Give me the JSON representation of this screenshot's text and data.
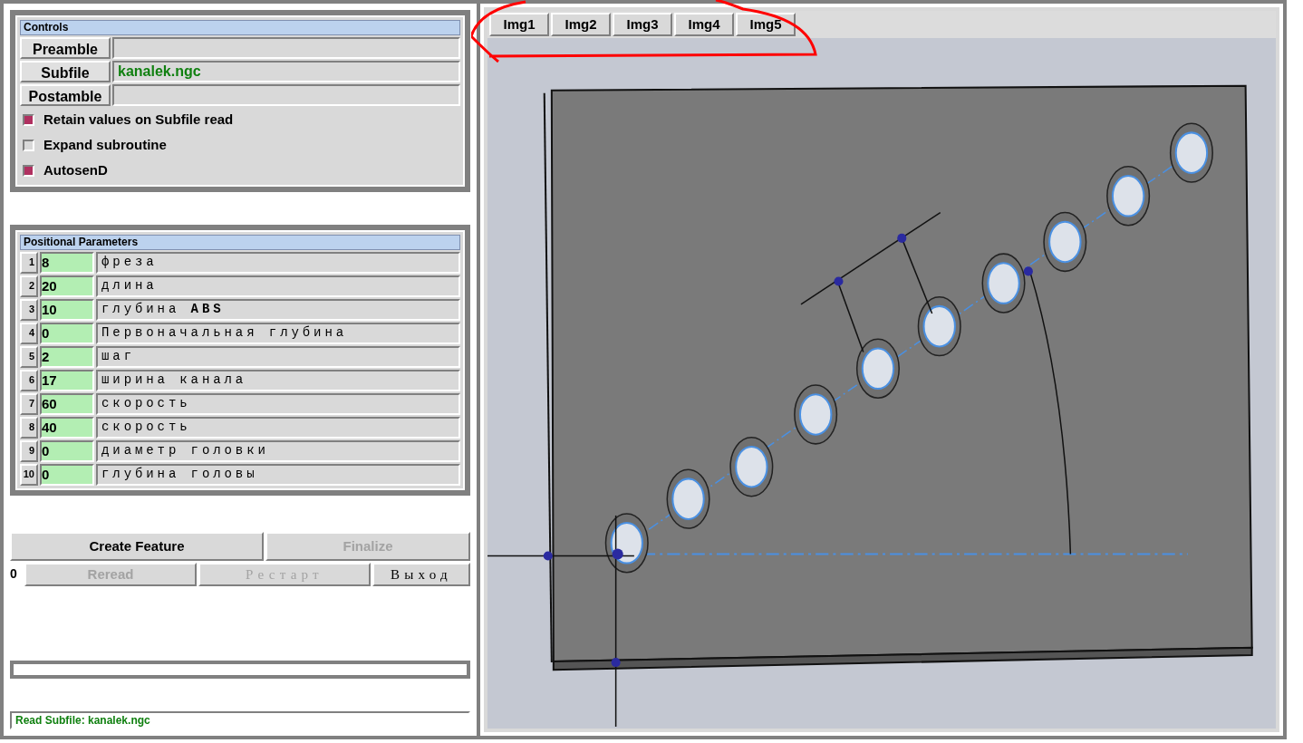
{
  "controls": {
    "title": "Controls",
    "file_rows": [
      {
        "button": "Preamble"
      },
      {
        "button": "Subfile",
        "value": "kanalek.ngc"
      },
      {
        "button": "Postamble"
      }
    ],
    "checkboxes": [
      {
        "label": "Retain values on Subfile read",
        "checked": true
      },
      {
        "label": "Expand subroutine",
        "checked": false
      },
      {
        "label": "AutosenD",
        "checked": true
      }
    ]
  },
  "positional_parameters": {
    "title": "Positional Parameters",
    "rows": [
      {
        "index": "1",
        "value": "8",
        "label": "фреза"
      },
      {
        "index": "2",
        "value": "20",
        "label": "длина"
      },
      {
        "index": "3",
        "value": "10",
        "label": "глубина **ABS**"
      },
      {
        "index": "4",
        "value": "0",
        "label": "Первоначальная глубина"
      },
      {
        "index": "5",
        "value": "2",
        "label": "шаг"
      },
      {
        "index": "6",
        "value": "17",
        "label": "ширина канала"
      },
      {
        "index": "7",
        "value": "60",
        "label": "скорость"
      },
      {
        "index": "8",
        "value": "40",
        "label": "скорость"
      },
      {
        "index": "9",
        "value": "0",
        "label": "диаметр головки"
      },
      {
        "index": "10",
        "value": "0",
        "label": "глубина головы"
      }
    ]
  },
  "actions": {
    "row_1": [
      {
        "label": "Create Feature",
        "disabled": false
      },
      {
        "label": "Finalize",
        "disabled": true
      }
    ],
    "counter": "0",
    "row_2": [
      {
        "label": "Reread",
        "disabled": true,
        "kind": "sans"
      },
      {
        "label": "Рестарт",
        "disabled": true,
        "kind": "serif"
      },
      {
        "label": "Выход",
        "disabled": false,
        "kind": "serif"
      }
    ]
  },
  "status_bar": "Read Subfile: kanalek.ngc",
  "image_tabs": [
    "Img1",
    "Img2",
    "Img3",
    "Img4",
    "Img5"
  ]
}
